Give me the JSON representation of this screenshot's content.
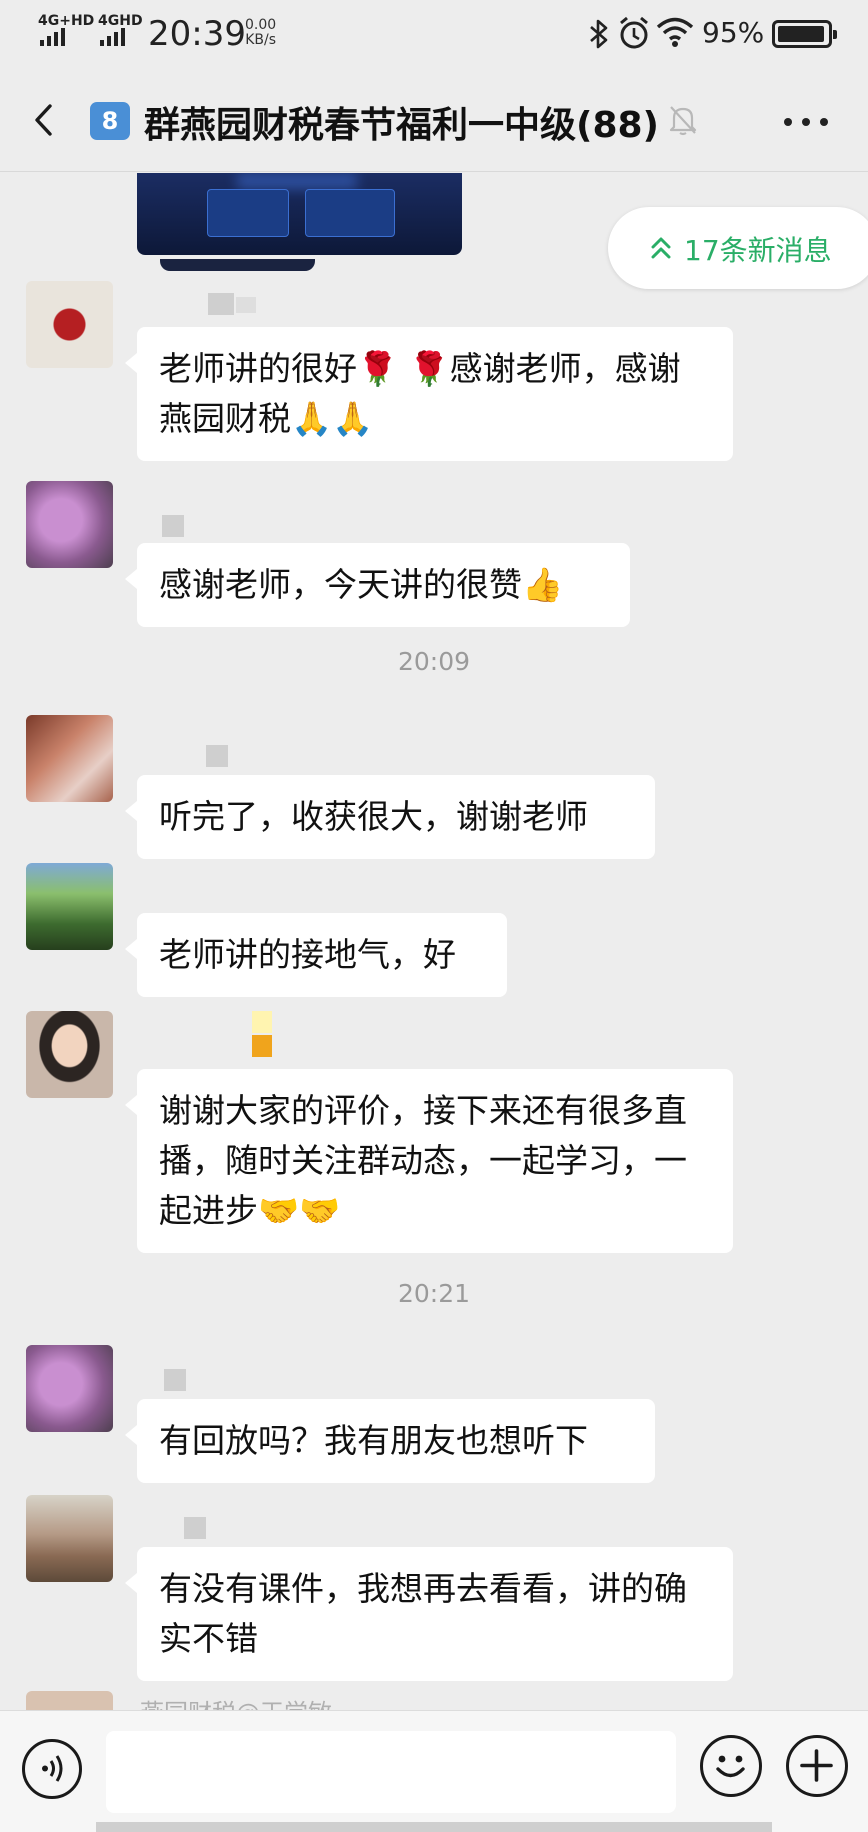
{
  "status_bar": {
    "signal1_label": "4G+HD",
    "signal2_label": "4GHD",
    "time": "20:39",
    "net_speed_value": "0.00",
    "net_speed_unit": "KB/s",
    "battery_percent": "95%",
    "battery_level": 0.95
  },
  "header": {
    "badge": "8",
    "title": "群燕园财税春节福利一中级(88)"
  },
  "new_messages_pill": "17条新消息",
  "messages": [
    {
      "text": "老师讲的很好🌹 🌹感谢老师，感谢燕园财税🙏🙏"
    },
    {
      "text": "感谢老师，今天讲的很赞👍"
    },
    {
      "text": "听完了，收获很大，谢谢老师"
    },
    {
      "text": "老师讲的接地气，好"
    },
    {
      "text": "谢谢大家的评价，接下来还有很多直播，随时关注群动态，一起学习，一起进步🤝🤝"
    },
    {
      "text": "有回放吗？我有朋友也想听下"
    },
    {
      "text": "有没有课件，我想再去看看，讲的确实不错"
    }
  ],
  "timestamps": [
    "20:09",
    "20:21"
  ],
  "partial_message": {
    "sender": "燕园财税",
    "mention": "@王学敏"
  },
  "colors": {
    "background": "#ededed",
    "accent_green": "#2aae67",
    "badge_blue": "#4a8fd6"
  },
  "icons": {
    "back": "chevron-left-icon",
    "mute": "bell-off-icon",
    "more": "more-dots-icon",
    "voice": "voice-icon",
    "emoji": "smiley-icon",
    "add": "plus-icon"
  }
}
